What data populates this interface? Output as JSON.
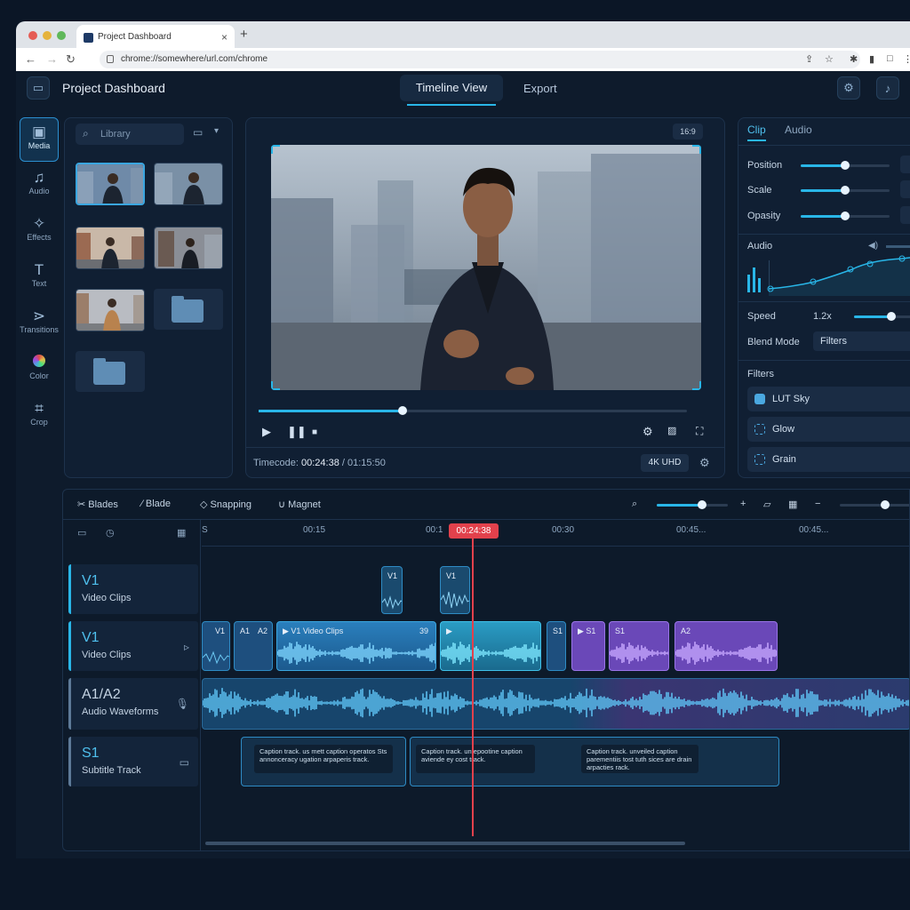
{
  "browser": {
    "tab_title": "Project Dashboard",
    "url": "chrome://somewhere/url.com/chrome",
    "close": "×",
    "new_tab": "+"
  },
  "header": {
    "title": "Project Dashboard",
    "tabs": [
      {
        "label": "Timeline View",
        "active": true
      },
      {
        "label": "Export",
        "active": false
      }
    ]
  },
  "toolbar": {
    "items": [
      {
        "label": "Media",
        "icon": "media-icon",
        "selected": true
      },
      {
        "label": "Audio",
        "icon": "music-note-icon"
      },
      {
        "label": "Effects",
        "icon": "sparkle-icon"
      },
      {
        "label": "Text",
        "icon": "text-icon"
      },
      {
        "label": "Transitions",
        "icon": "transition-icon"
      },
      {
        "label": "Color",
        "icon": "color-wheel-icon"
      },
      {
        "label": "Crop",
        "icon": "crop-icon"
      }
    ]
  },
  "library": {
    "search_placeholder": "Library"
  },
  "preview": {
    "aspect": "16:9",
    "timecode_label": "Timecode:",
    "timecode_current": "00:24:38",
    "timecode_total": "/ 01:15:50",
    "resolution": "4K UHD",
    "progress": 0.335
  },
  "inspector": {
    "tabs": [
      {
        "label": "Clip",
        "active": true
      },
      {
        "label": "Audio",
        "active": false
      }
    ],
    "properties": [
      {
        "label": "Position",
        "value": 0.5
      },
      {
        "label": "Scale",
        "value": 0.5
      },
      {
        "label": "Opasity",
        "value": 0.5
      }
    ],
    "audio_label": "Audio",
    "speed_label": "Speed",
    "speed_value": "1.2x",
    "blend_label": "Blend Mode",
    "blend_value": "Filters",
    "filters_label": "Filters",
    "filters": [
      {
        "name": "LUT Sky",
        "color": "#4aa8e0"
      },
      {
        "name": "Glow",
        "color": "#2f6f9a"
      },
      {
        "name": "Grain",
        "color": "#2f6f9a"
      }
    ]
  },
  "timeline": {
    "tools": [
      "Blades",
      "Blade",
      "Snapping",
      "Magnet"
    ],
    "ruler": [
      "S",
      "00:15",
      "00:1",
      "00:30",
      "00:45...",
      "00:45..."
    ],
    "playhead": "00:24:38",
    "tracks": [
      {
        "name": "V1",
        "subtitle": "Video Clips"
      },
      {
        "name": "V1",
        "subtitle": "Video Clips"
      },
      {
        "name": "A1/A2",
        "subtitle": "Audio Waveforms"
      },
      {
        "name": "S1",
        "subtitle": "Subtitle Track"
      }
    ],
    "clips": {
      "v1_small_a": "V1",
      "v1_small_b": "V1",
      "row2": [
        "V1",
        "A1",
        "A2",
        "V1 Video Clips",
        "S1",
        "S1",
        "A2"
      ],
      "row2_extra": "S1",
      "row2_dup": "39"
    },
    "captions": [
      "Caption track. us mett caption operatos Sts annonceracy ugation arpaperis track.",
      "Caption track. unfepootine caption aviende ey cost track.",
      "Caption track. unveiled caption parementiis tost tuth sices are drain arpacties rack."
    ]
  },
  "colors": {
    "accent": "#29b6e8",
    "playhead": "#e2414c",
    "purple": "#8b5fd6"
  }
}
